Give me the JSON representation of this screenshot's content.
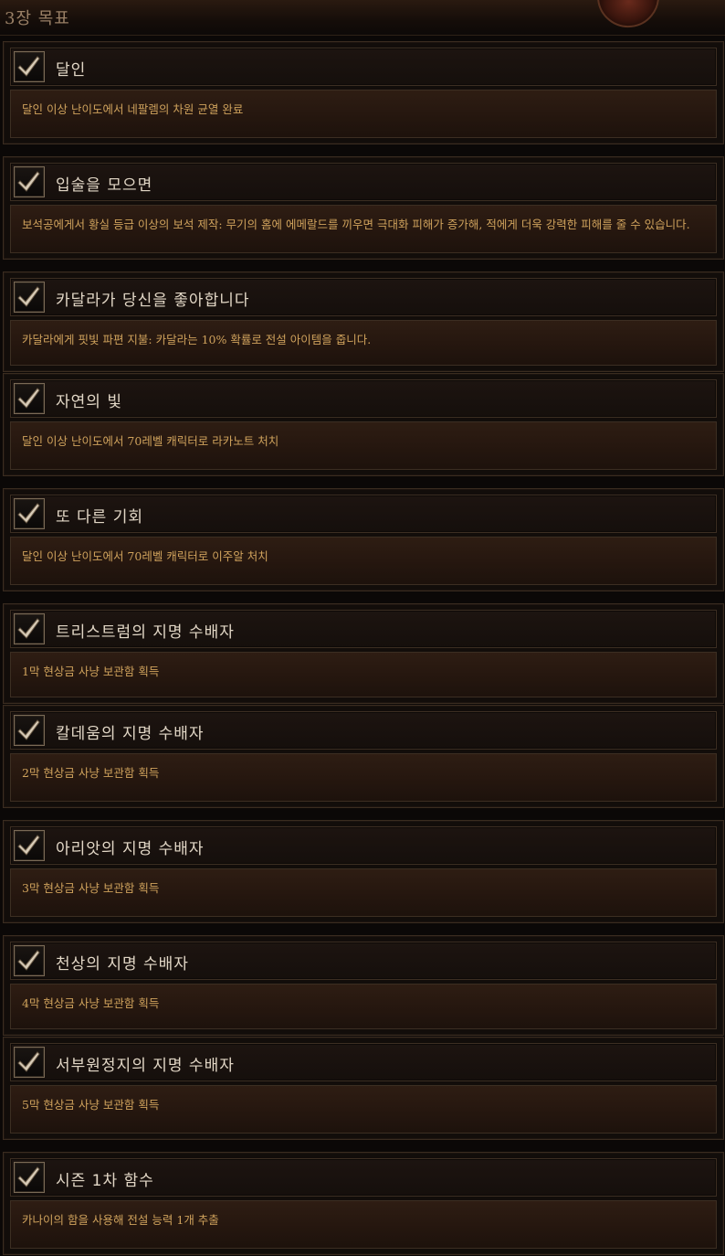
{
  "header": {
    "title": "3장 목표"
  },
  "achievements": [
    {
      "title": "달인",
      "description": "달인 이상 난이도에서 네팔렘의 차원 균열 완료",
      "completed": true
    },
    {
      "title": "입술을 모으면",
      "description": "보석공에게서 황실 등급 이상의 보석 제작: 무기의 홈에 에메랄드를 끼우면 극대화 피해가 증가해, 적에게 더욱 강력한 피해를 줄 수 있습니다.",
      "completed": true
    },
    {
      "title": "카달라가 당신을 좋아합니다",
      "description": "카달라에게 핏빛 파편 지불: 카달라는 10% 확률로 전설 아이템을 줍니다.",
      "completed": true
    },
    {
      "title": "자연의 빛",
      "description": "달인 이상 난이도에서 70레벨 캐릭터로 라카노트 처치",
      "completed": true
    },
    {
      "title": "또 다른 기회",
      "description": "달인 이상 난이도에서 70레벨 캐릭터로 이주알 처치",
      "completed": true
    },
    {
      "title": "트리스트럼의 지명 수배자",
      "description": "1막 현상금 사냥 보관함 획득",
      "completed": true
    },
    {
      "title": "칼데움의 지명 수배자",
      "description": "2막 현상금 사냥 보관함 획득",
      "completed": true
    },
    {
      "title": "아리앗의 지명 수배자",
      "description": "3막 현상금 사냥 보관함 획득",
      "completed": true
    },
    {
      "title": "천상의 지명 수배자",
      "description": "4막 현상금 사냥 보관함 획득",
      "completed": true
    },
    {
      "title": "서부원정지의 지명 수배자",
      "description": "5막 현상금 사냥 보관함 획득",
      "completed": true
    },
    {
      "title": "시즌 1차 함수",
      "description": "카나이의 함을 사용해 전설 능력 1개 추출",
      "completed": true
    }
  ]
}
